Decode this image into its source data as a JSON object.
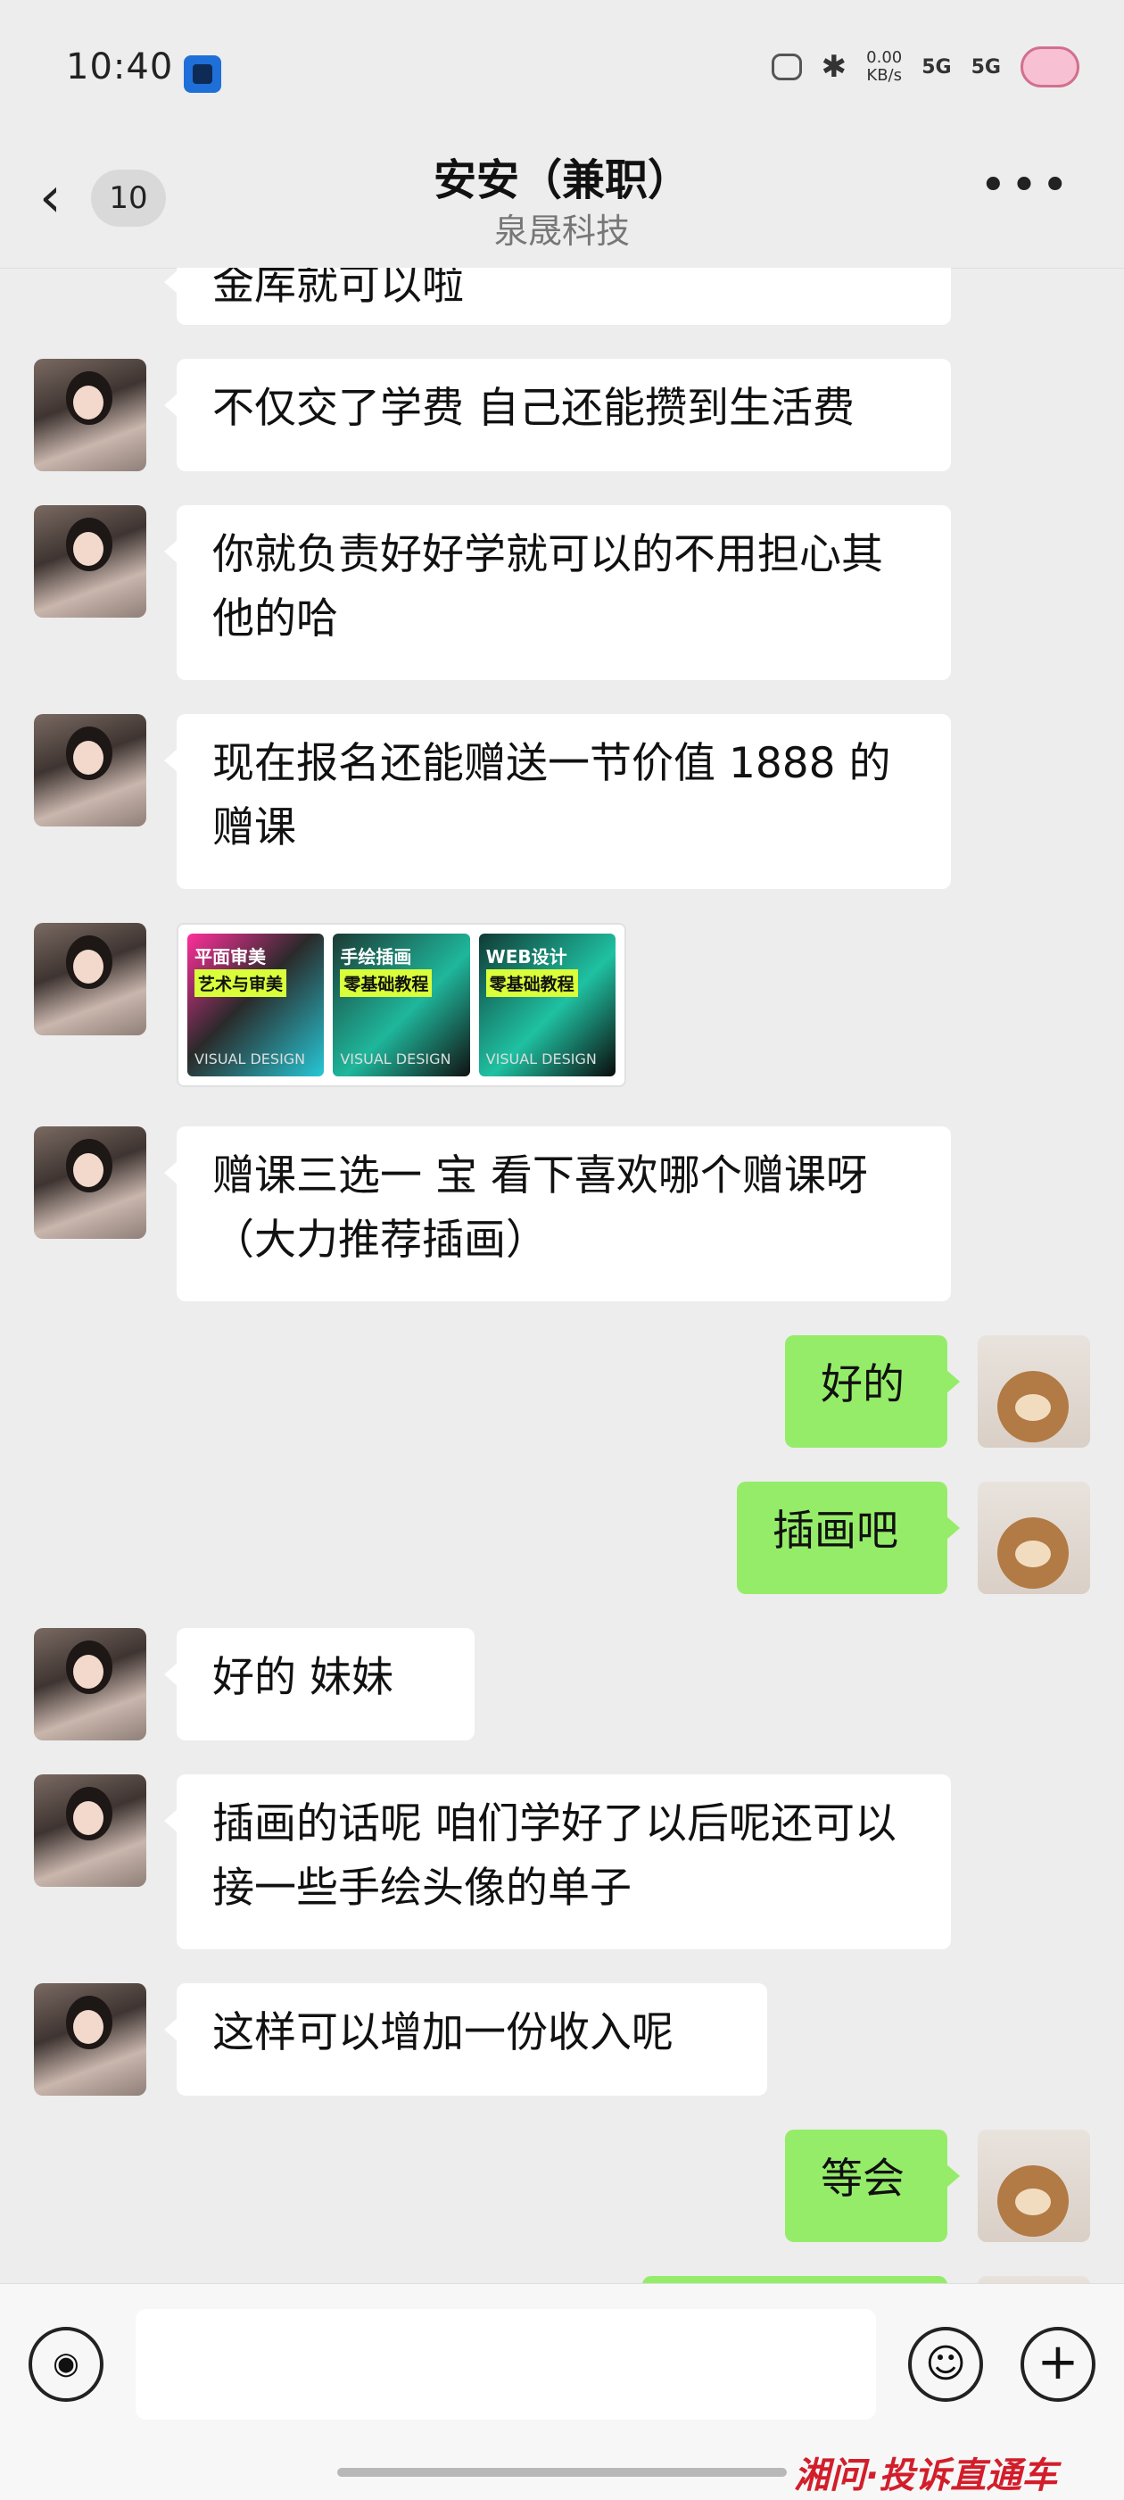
{
  "status_bar": {
    "time": "10:40",
    "speed_value": "0.00",
    "speed_unit": "KB/s",
    "signal1": "5G",
    "signal2": "5G",
    "icons": [
      "app-icon",
      "cat-icon",
      "bluetooth-icon",
      "signal-icon",
      "pig-icon"
    ]
  },
  "header": {
    "back_icon": "chevron-left-icon",
    "unread_count": "10",
    "title": "安安（兼职）",
    "subtitle": "泉晟科技",
    "more_icon": "more-icon"
  },
  "messages": [
    {
      "side": "left",
      "type": "text",
      "text": "金库就可以啦"
    },
    {
      "side": "left",
      "type": "text",
      "text": "不仅交了学费 自己还能攒到生活费"
    },
    {
      "side": "left",
      "type": "text",
      "text": "你就负责好好学就可以的不用担心其他的哈"
    },
    {
      "side": "left",
      "type": "text",
      "text": "现在报名还能赠送一节价值 1888 的赠课"
    },
    {
      "side": "left",
      "type": "image",
      "tiles": [
        {
          "title": "平面审美",
          "sub": "艺术与审美",
          "foot": "VISUAL DESIGN"
        },
        {
          "title": "手绘插画",
          "sub": "零基础教程",
          "foot": "VISUAL DESIGN"
        },
        {
          "title": "WEB设计",
          "sub": "零基础教程",
          "foot": "VISUAL DESIGN"
        }
      ]
    },
    {
      "side": "left",
      "type": "text",
      "text": "赠课三选一 宝 看下喜欢哪个赠课呀（大力推荐插画）"
    },
    {
      "side": "right",
      "type": "text",
      "text": "好的"
    },
    {
      "side": "right",
      "type": "text",
      "text": "插画吧"
    },
    {
      "side": "left",
      "type": "text",
      "text": "好的 妹妹"
    },
    {
      "side": "left",
      "type": "text",
      "text": "插画的话呢 咱们学好了以后呢还可以接一些手绘头像的单子"
    },
    {
      "side": "left",
      "type": "text",
      "text": "这样可以增加一份收入呢"
    },
    {
      "side": "right",
      "type": "text",
      "text": "等会"
    }
  ],
  "input_bar": {
    "voice_icon": "voice-icon",
    "emoji_icon": "emoji-icon",
    "plus_icon": "plus-icon",
    "voice_glyph": "◉",
    "emoji_glyph": "☺",
    "plus_glyph": "+"
  },
  "watermark": "湘问·投诉直通车",
  "colors": {
    "background": "#ededed",
    "bubble_left": "#ffffff",
    "bubble_right": "#95ec69",
    "watermark": "#d21e2b"
  }
}
